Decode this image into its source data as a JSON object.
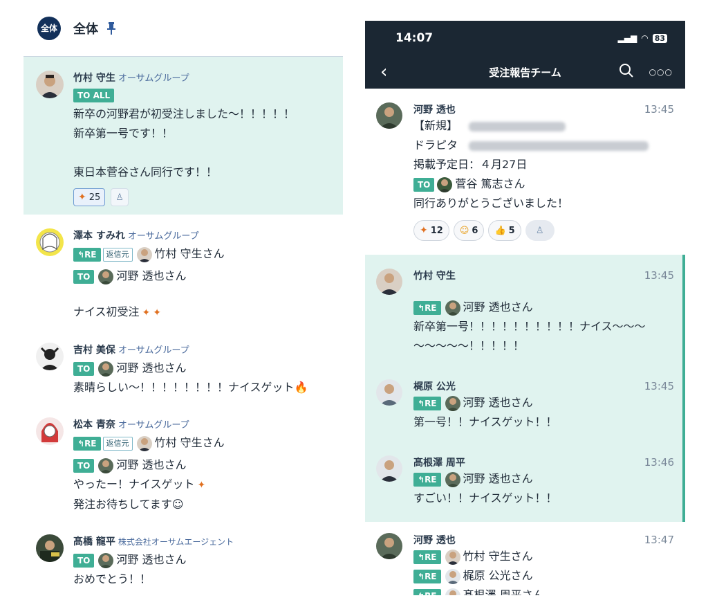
{
  "left": {
    "room_avatar": "全体",
    "room_name": "全体",
    "messages": [
      {
        "name": "竹村 守生",
        "org": "オーサムグループ",
        "tag": "TO ALL",
        "lines": [
          "新卒の河野君が初受注しました～！！！！！",
          "新卒第一号です！！",
          "",
          "東日本菅谷さん同行です！！"
        ],
        "reaction_count": "25"
      },
      {
        "name": "澤本 すみれ",
        "org": "オーサムグループ",
        "re": "RE",
        "src": "返信元",
        "re_to": "竹村 守生さん",
        "to": "TO",
        "to_name": "河野 透也さん",
        "line": "ナイス初受注"
      },
      {
        "name": "吉村 美保",
        "org": "オーサムグループ",
        "to": "TO",
        "to_name": "河野 透也さん",
        "line": "素晴らしい～！！！！！！！！ナイスゲット"
      },
      {
        "name": "松本 青奈",
        "org": "オーサムグループ",
        "re": "RE",
        "src": "返信元",
        "re_to": "竹村 守生さん",
        "to": "TO",
        "to_name": "河野 透也さん",
        "line1": "やったー！ナイスゲット",
        "line2": "発注お待ちしてます☺"
      },
      {
        "name": "髙橋 龍平",
        "org": "株式会社オーサムエージェント",
        "to": "TO",
        "to_name": "河野 透也さん",
        "line": "おめでとう！！"
      }
    ]
  },
  "right": {
    "status": {
      "time": "14:07",
      "battery": "83"
    },
    "nav": {
      "title": "受注報告チーム"
    },
    "messages": [
      {
        "name": "河野 透也",
        "time": "13:45",
        "line1": "【新規】",
        "line2": "ドラピタ",
        "line3": "掲載予定日：４月27日",
        "to": "TO",
        "to_name": "菅谷 篤志さん",
        "line4": "同行ありがとうございました！",
        "reactions": [
          "12",
          "6",
          "5"
        ]
      },
      {
        "name": "竹村 守生",
        "time": "13:45",
        "re": "RE",
        "re_to": "河野 透也さん",
        "line1": "新卒第一号！！！！！！！！！！ナイス～～～",
        "line2": "～～～～～！！！！！"
      },
      {
        "name": "梶原 公光",
        "time": "13:45",
        "re": "RE",
        "re_to": "河野 透也さん",
        "line": "第一号！！ナイスゲット！！"
      },
      {
        "name": "髙根澤 周平",
        "time": "13:46",
        "re": "RE",
        "re_to": "河野 透也さん",
        "line": "すごい！！ナイスゲット！！"
      },
      {
        "name": "河野 透也",
        "time": "13:47",
        "re": "RE",
        "re_to1": "竹村 守生さん",
        "re_to2": "梶原 公光さん",
        "re_to3": "髙根澤 周平さん"
      }
    ]
  },
  "colors": {
    "accent": "#3fae95",
    "highlight": "#e0f3ef",
    "nav": "#1b2733"
  }
}
